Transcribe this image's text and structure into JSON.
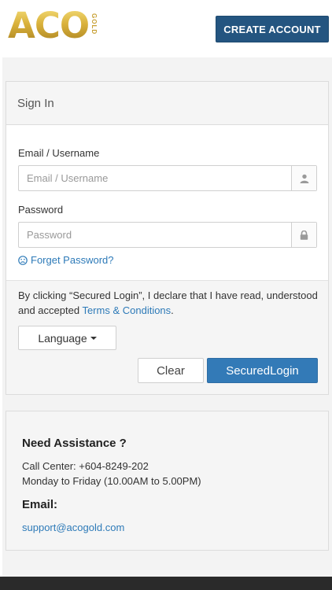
{
  "header": {
    "logo_text": "ACO",
    "logo_sub": "GOLD",
    "create_account_label": "CREATE ACCOUNT"
  },
  "signin": {
    "title": "Sign In",
    "email_label": "Email / Username",
    "email_placeholder": "Email / Username",
    "email_value": "",
    "password_label": "Password",
    "password_placeholder": "Password",
    "password_value": "",
    "forget_label": "Forget Password?",
    "notice_text": "By clicking “Secured Login”, I declare that I have read, understood and accepted ",
    "terms_label": "Terms & Conditions",
    "notice_end": ".",
    "language_label": "Language",
    "clear_label": "Clear",
    "login_label": "SecuredLogin"
  },
  "assistance": {
    "title": "Need Assistance ?",
    "call_center": "Call Center: +604-8249-202",
    "hours": "Monday to Friday (10.00AM to 5.00PM)",
    "email_label": "Email:",
    "email": "support@acogold.com"
  },
  "icons": {
    "user": "user-icon",
    "lock": "lock-icon",
    "forget": "sad-face-icon",
    "caret": "caret-down-icon"
  },
  "colors": {
    "primary": "#337ab7",
    "header_button": "#245580",
    "link": "#2d7ab8",
    "logo_gold": "#d6b13a"
  }
}
